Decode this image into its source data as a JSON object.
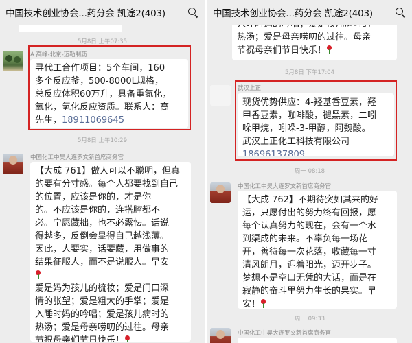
{
  "left": {
    "title": "中国技术创业协会...药分会 凯途2(403)",
    "timestamps": [
      "5月8日 上午07:35",
      "5月8日 上午10:29"
    ],
    "msg1": {
      "sender": "A 高峰-北京-迈勒制药",
      "lines": [
        "寻代工合作项目：5个车间，160",
        "多个反应釜，500-8000L规格，",
        "总反应体积60万升，具备重氮化，",
        "氧化，氢化反应资质。联系人：高",
        "先生，"
      ],
      "phone": "18911069645"
    },
    "msg2": {
      "sender": "中国化工中昊大连罗文新首席商务官",
      "lines": [
        "【大成 761】做人可以不聪明，但真",
        "的要有分寸感。每个人都要找到自己",
        "的位置，应该是你的，才是你",
        "的。不应该是你的，连搭腔都不",
        "必。宁愿藏拙，也不必露怯。话说",
        "得越多，反倒会显得自己越浅薄。",
        "因此，人要实，话要藏，用做事的",
        "结果征服人，而不是说服人。早安"
      ],
      "lines2": [
        "爱是妈为孩儿的梳妆；爱是门口深",
        "情的张望；爱是粗大的手掌；爱是",
        "入睡时妈的吟唱；爱是孩儿病时的",
        "热汤；爱是母亲唠叨的过往。母亲",
        "节祝母亲们节日快乐！"
      ]
    }
  },
  "right": {
    "title": "中国技术创业协会...药分会 凯途2(403)",
    "top_lines": [
      "入睡时妈的吟唱；爱是孩儿病时的",
      "热汤；爱是母亲唠叨的过往。母亲",
      "节祝母亲们节日快乐！"
    ],
    "timestamps": [
      "5月8日 下午17:04",
      "周一 08:18",
      "周一 09:33"
    ],
    "msg1": {
      "sender": "武汉上正",
      "lines": [
        "现货优势供应：4-羟基香豆素，羟",
        "甲香豆素，咖啡酸，褪黑素，二吲",
        "哚甲烷，吲哚-3-甲醇，阿魏酸。",
        "武汉上正化工科技有限公司"
      ],
      "phone": "18696137809"
    },
    "msg2": {
      "sender": "中国化工中昊大连罗文新首席商务官",
      "lines": [
        "【大成 762】不期待突如其来的好",
        "运，只愿付出的努力终有回报，愿",
        "每个认真努力的现在，会有一个水",
        "到渠成的未来。不辜负每一场花",
        "开，善待每一次花落，收藏每一寸",
        "清风朗月，迎着阳光，迈开步子。",
        "梦想不是空口无凭的大话，而是在",
        "寂静的奋斗里努力生长的果实。早",
        "安！"
      ]
    },
    "msg3": {
      "sender": "中国化工中昊大连罗文新首席商务官"
    }
  },
  "colors": {
    "highlight": "#d42323",
    "phone_link": "#576b95",
    "background": "#ededed"
  }
}
